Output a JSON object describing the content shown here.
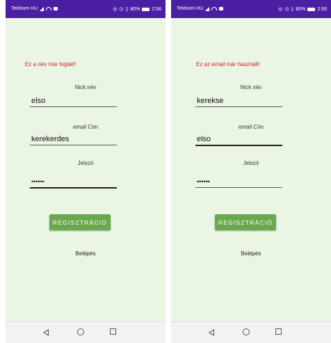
{
  "status_bar": {
    "carrier": "Telekom HU",
    "battery": "80%",
    "time": "2:56"
  },
  "left_screen": {
    "error_message": "Ez a név már foglalt!",
    "nick_label": "Nick név",
    "nick_value": "elso",
    "email_label": "email Cím",
    "email_value": "kerekerdes",
    "password_label": "Jelszó",
    "password_value": "••••••",
    "register_button": "REGISZTRÁCIÓ",
    "login_link": "Belépés"
  },
  "right_screen": {
    "error_message": "Ez az email már használt!",
    "nick_label": "Nick név",
    "nick_value": "kerekse",
    "email_label": "email Cím",
    "email_value": "elso",
    "password_label": "Jelszó",
    "password_value": "••••••",
    "register_button": "REGISZTRÁCIÓ",
    "login_link": "Belépés"
  },
  "colors": {
    "status_bar": "#4b1fa4",
    "background": "#eaf5e3",
    "error_text": "#c62828",
    "button": "#6aa84f"
  },
  "icons": [
    "signal-icon",
    "wifi-icon",
    "message-icon",
    "location-icon",
    "alarm-icon",
    "vibrate-icon",
    "battery-icon",
    "nav-back-icon",
    "nav-home-icon",
    "nav-recent-icon"
  ]
}
